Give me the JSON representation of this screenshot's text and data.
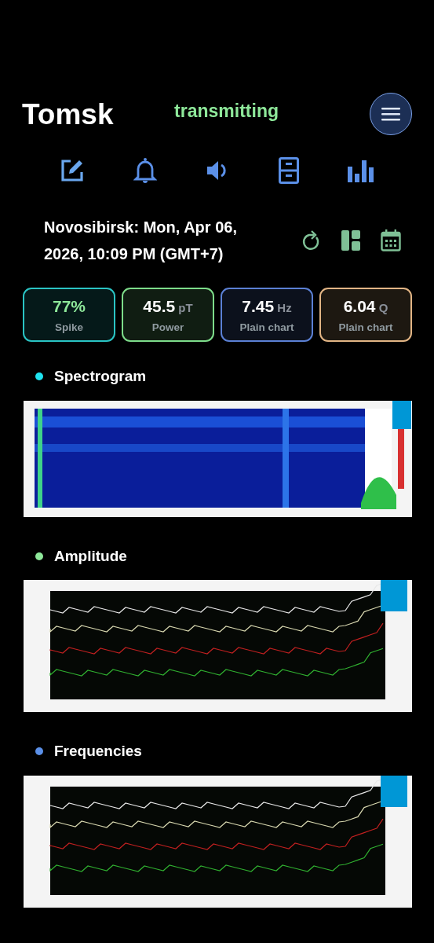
{
  "header": {
    "title": "Tomsk",
    "status": "transmitting"
  },
  "toolbar": [
    {
      "kind": "edit"
    },
    {
      "kind": "bell"
    },
    {
      "kind": "sound"
    },
    {
      "kind": "cabinet"
    },
    {
      "kind": "bars"
    }
  ],
  "datetime": {
    "text": "Novosibirsk: Mon, Apr 06, 2026, 10:09 PM (GMT+7)",
    "actions": [
      {
        "kind": "refresh"
      },
      {
        "kind": "layout"
      },
      {
        "kind": "calendar"
      }
    ]
  },
  "stats": [
    {
      "value": "77%",
      "label": "Spike",
      "color": "#2ac4c4",
      "accent": true
    },
    {
      "value": "45.5",
      "unit": "pT",
      "label": "Power",
      "color": "#7ddc8a",
      "accent": false
    },
    {
      "value": "7.45",
      "unit": "Hz",
      "label": "Plain chart",
      "color": "#5b80d4",
      "accent": false
    },
    {
      "value": "6.04",
      "unit": "Q",
      "label": "Plain chart",
      "color": "#e2b585",
      "accent": false
    }
  ],
  "sections": [
    {
      "title": "Spectrogram",
      "color": "#1fe3f0",
      "kind": "spectrogram"
    },
    {
      "title": "Amplitude",
      "color": "#8ee89a",
      "kind": "plot"
    },
    {
      "title": "Frequencies",
      "color": "#5b90e8",
      "kind": "plot"
    }
  ]
}
